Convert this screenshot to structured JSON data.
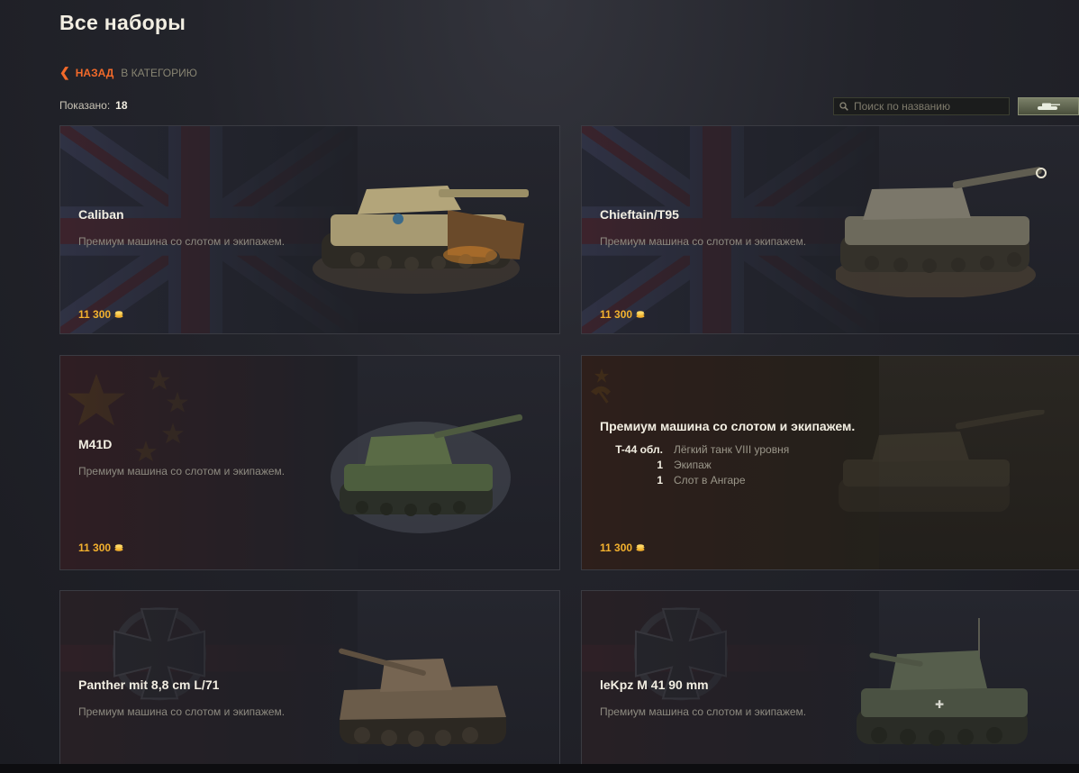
{
  "header": {
    "title": "Все наборы",
    "back_label": "НАЗАД",
    "category_label": "В КАТЕГОРИЮ",
    "shown_label": "Показано:",
    "shown_count": "18"
  },
  "search": {
    "placeholder": "Поиск по названию",
    "value": ""
  },
  "colors": {
    "accent_orange": "#f26a2a",
    "gold": "#f3b12e"
  },
  "cards": [
    {
      "name": "Caliban",
      "description": "Премиум машина со слотом и экипажем.",
      "price": "11 300",
      "flag": "uk-flag"
    },
    {
      "name": "Chieftain/T95",
      "description": "Премиум машина со слотом и экипажем.",
      "price": "11 300",
      "flag": "uk-flag"
    },
    {
      "name": "M41D",
      "description": "Премиум машина со слотом и экипажем.",
      "price": "11 300",
      "flag": "china-flag"
    },
    {
      "title": "Премиум машина со слотом и экипажем.",
      "items": [
        {
          "qty": "T-44 обл.",
          "label": "Лёгкий танк VIII уровня"
        },
        {
          "qty": "1",
          "label": "Экипаж"
        },
        {
          "qty": "1",
          "label": "Слот в Ангаре"
        }
      ],
      "price": "11 300",
      "flag": "ussr-flag"
    },
    {
      "name": "Panther mit 8,8 cm L/71",
      "description": "Премиум машина со слотом и экипажем.",
      "price": "",
      "flag": "germany-flag"
    },
    {
      "name": "leKpz M 41 90 mm",
      "description": "Премиум машина со слотом и экипажем.",
      "price": "",
      "flag": "germany-flag"
    }
  ]
}
